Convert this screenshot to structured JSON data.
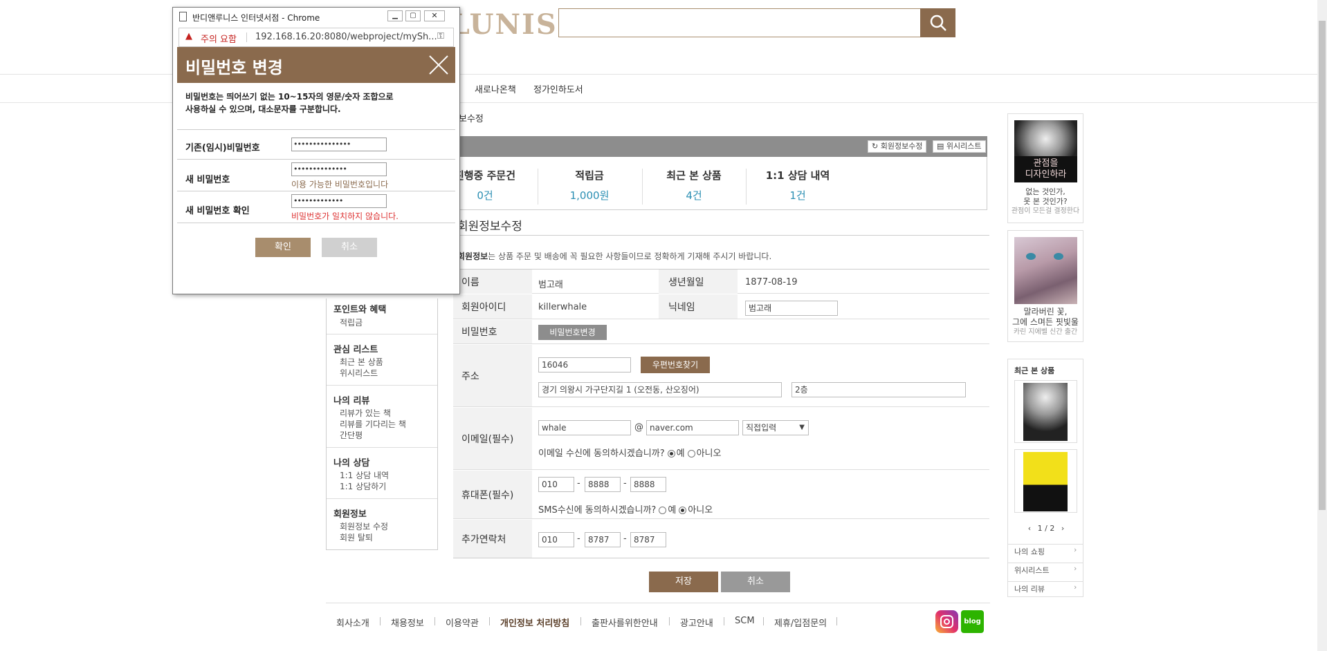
{
  "header": {
    "logo_text": "BANDI LUNIS",
    "search_placeholder": ""
  },
  "gnb": {
    "items": [
      "새로나온책",
      "정가인하도서"
    ]
  },
  "breadcrumb": "보수정",
  "summary": {
    "edit_button": "회원정보수정",
    "wishlist_button": "위시리스트",
    "items": [
      {
        "title": "진행중 주문건",
        "value": "0건"
      },
      {
        "title": "적립금",
        "value": "1,000원"
      },
      {
        "title": "최근 본 상품",
        "value": "4건"
      },
      {
        "title": "1:1 상담 내역",
        "value": "1건"
      }
    ]
  },
  "section": {
    "title": "회원정보수정",
    "desc_bold": "회원정보",
    "desc_rest": "는 상품 주문 및 배송에 꼭 필요한 사항들이므로 정확하게 기재해 주시기 바랍니다."
  },
  "form": {
    "name_label": "이름",
    "name_value": "범고래",
    "birth_label": "생년월일",
    "birth_value": "1877-08-19",
    "id_label": "회원아이디",
    "id_value": "killerwhale",
    "nick_label": "닉네임",
    "nick_value": "범고래",
    "pw_label": "비밀번호",
    "pw_button": "비밀번호변경",
    "addr_label": "주소",
    "zip_value": "16046",
    "zip_button": "우편번호찾기",
    "addr1_value": "경기 의왕시 가구단지길 1 (오전동, 산오징어)",
    "addr2_value": "2층",
    "email_label": "이메일(필수)",
    "email_id": "whale",
    "email_at": "@",
    "email_domain": "naver.com",
    "email_select": "직접입력",
    "email_agree_q": "이메일 수신에 동의하시겠습니까?",
    "yes": "예",
    "no": "아니오",
    "phone_label": "휴대폰(필수)",
    "phone": [
      "010",
      "8888",
      "8888"
    ],
    "sms_agree_q": "SMS수신에 동의하시겠습니까?",
    "extra_label": "추가연락처",
    "extra": [
      "010",
      "8787",
      "8787"
    ],
    "dash": "-",
    "save_button": "저장",
    "cancel_button": "취소"
  },
  "sidebar": {
    "groups": [
      {
        "title": "포인트와 혜택",
        "items": [
          "적립금"
        ]
      },
      {
        "title": "관심 리스트",
        "items": [
          "최근 본 상품",
          "위시리스트"
        ]
      },
      {
        "title": "나의 리뷰",
        "items": [
          "리뷰가 있는 책",
          "리뷰를 기다리는 책",
          "간단평"
        ]
      },
      {
        "title": "나의 상담",
        "items": [
          "1:1 상담 내역",
          "1:1 상담하기"
        ]
      },
      {
        "title": "회원정보",
        "items": [
          "회원정보 수정",
          "회원 탈퇴"
        ]
      }
    ]
  },
  "right": {
    "banner1_lines": [
      "없는 것인가,",
      "못 본 것인가?",
      "관점이 모든걸 결정한다"
    ],
    "banner1_cover": "관점을\n디자인하라",
    "banner2_lines": [
      "말라버린 꽃,",
      "그에 스며든 핏빛울",
      "카린 지에벨 신간 출간"
    ],
    "recent_title": "최근 본 상품",
    "pager": "1 / 2",
    "links": [
      "나의 쇼핑",
      "위시리스트",
      "나의 리뷰"
    ]
  },
  "footer": {
    "links": [
      "회사소개",
      "채용정보",
      "이용약관",
      "개인정보 처리방침",
      "출판사를위한안내",
      "광고안내",
      "SCM",
      "제휴/입점문의"
    ],
    "blog_label": "blog"
  },
  "popup": {
    "window_title": "반디앤루니스 인터넷서점 - Chrome",
    "warning_label": "주의 요함",
    "url": "192.168.16.20:8080/webproject/mySh...",
    "title": "비밀번호 변경",
    "desc_line1": "비밀번호는 띄어쓰기 없는 10~15자의 영문/숫자 조합으로",
    "desc_line2": "사용하실 수 있으며, 대소문자를 구분합니다.",
    "current_label": "기존(임시)비밀번호",
    "current_value": "•••••••••••••••",
    "new_label": "새 비밀번호",
    "new_value": "••••••••••••••",
    "new_msg": "이용 가능한 비밀번호입니다",
    "confirm_label": "새 비밀번호 확인",
    "confirm_value": "•••••••••••••",
    "confirm_msg": "비밀번호가 일치하지 않습니다.",
    "ok_button": "확인",
    "cancel_button": "취소"
  }
}
